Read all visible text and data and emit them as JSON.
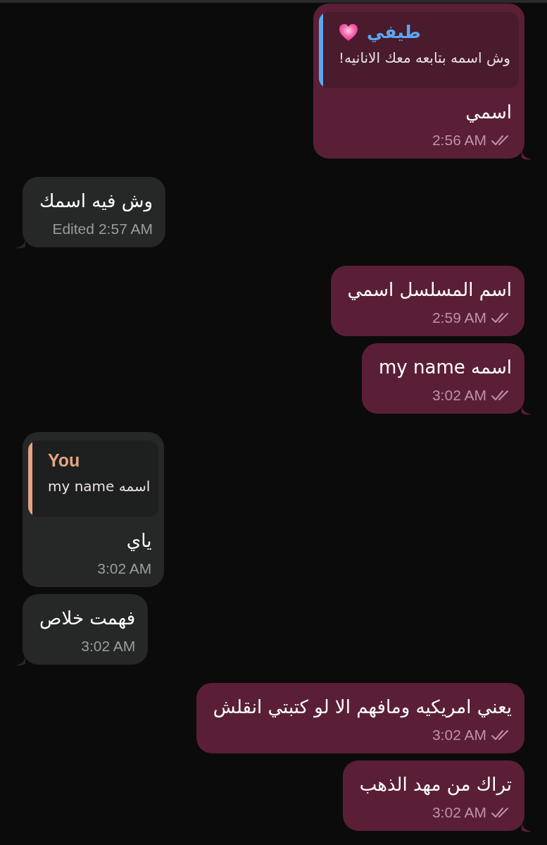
{
  "messages": [
    {
      "kind": "outgoing",
      "reply": {
        "name": "طيفي",
        "heart": true,
        "text": "وش اسمه بتابعه معك الانانيه!",
        "color": "#5aa8f0"
      },
      "text": "اسمي",
      "time": "2:56 AM",
      "read": true,
      "tail": true
    },
    {
      "kind": "incoming",
      "edited_label": "Edited",
      "text": "وش فيه اسمك",
      "time": "2:57 AM",
      "tail": true
    },
    {
      "kind": "outgoing",
      "text": "اسم المسلسل اسمي",
      "time": "2:59 AM",
      "read": true,
      "tail": false
    },
    {
      "kind": "outgoing",
      "text": "اسمه my name",
      "time": "3:02 AM",
      "read": true,
      "tail": true
    },
    {
      "kind": "incoming",
      "reply": {
        "name": "You",
        "text": "اسمه my name",
        "color": "#e3a484"
      },
      "text": "ياي",
      "time": "3:02 AM",
      "tail": false
    },
    {
      "kind": "incoming",
      "text": "فهمت خلاص",
      "time": "3:02 AM",
      "tail": true
    },
    {
      "kind": "outgoing",
      "text": "يعني امريكيه ومافهم الا لو كتبتي انقلش",
      "time": "3:02 AM",
      "read": true,
      "tail": false
    },
    {
      "kind": "outgoing",
      "text": "تراك من مهد الذهب",
      "time": "3:02 AM",
      "read": true,
      "tail": true
    }
  ]
}
